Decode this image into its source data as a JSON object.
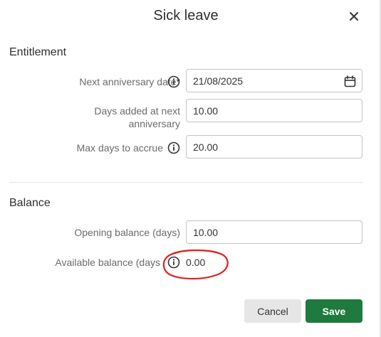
{
  "dialog": {
    "title": "Sick leave",
    "close_icon": "close-icon"
  },
  "entitlement": {
    "section_title": "Entitlement",
    "next_anniversary": {
      "label": "Next anniversary date",
      "required_mark": "*",
      "value": "21/08/2025",
      "icon": "calendar-icon"
    },
    "days_added": {
      "label": "Days added at next anniversary",
      "value": "10.00"
    },
    "max_days": {
      "label": "Max days to accrue",
      "value": "20.00"
    }
  },
  "balance": {
    "section_title": "Balance",
    "opening": {
      "label": "Opening balance (days)",
      "value": "10.00"
    },
    "available": {
      "label": "Available balance (days",
      "value": "0.00"
    }
  },
  "footer": {
    "cancel_label": "Cancel",
    "save_label": "Save"
  },
  "colors": {
    "save_button": "#1e7a3e",
    "cancel_button": "#e6e6e6",
    "annotation_circle": "#e02020"
  }
}
